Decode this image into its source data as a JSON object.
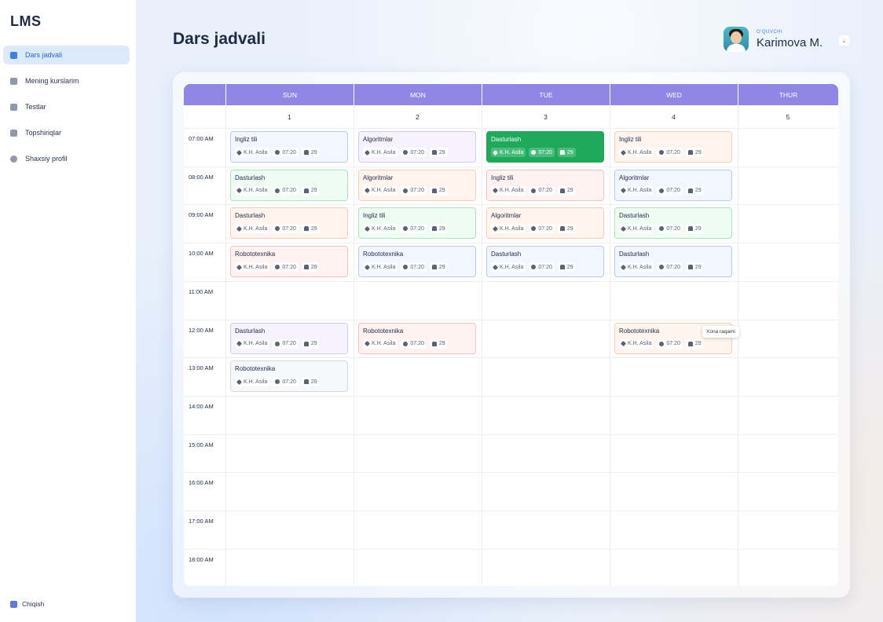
{
  "app": {
    "logo": "LMS",
    "page_title": "Dars jadvali"
  },
  "sidebar": {
    "items": [
      {
        "label": "Dars jadvali",
        "icon": "home-icon",
        "active": true
      },
      {
        "label": "Mening kurslarim",
        "icon": "courses-icon"
      },
      {
        "label": "Testlar",
        "icon": "tests-icon"
      },
      {
        "label": "Topshiriqlar",
        "icon": "tasks-icon"
      },
      {
        "label": "Shaxsiy profil",
        "icon": "user-icon"
      }
    ],
    "logout_label": "Chiqish"
  },
  "user": {
    "role": "O'QUVCHI",
    "name": "Karimova M."
  },
  "calendar": {
    "days": [
      "SUN",
      "MON",
      "TUE",
      "WED",
      "THUR"
    ],
    "dates": [
      "1",
      "2",
      "3",
      "4",
      "5"
    ],
    "times": [
      "07:00 AM",
      "08:00 AM",
      "09:00 AM",
      "10:00 AM",
      "11:00 AM",
      "12:00 AM",
      "13:00 AM",
      "14:00 AM",
      "15:00 AM",
      "16:00 AM",
      "17:00 AM",
      "18:00 AM"
    ],
    "events": [
      {
        "day": 0,
        "slot": 0,
        "title": "Ingliz tili",
        "teacher": "K.H. Asila",
        "time": "07:20",
        "room": "29",
        "color": "blue"
      },
      {
        "day": 1,
        "slot": 0,
        "title": "Algoritmlar",
        "teacher": "K.H. Asila",
        "time": "07:20",
        "room": "29",
        "color": "purple"
      },
      {
        "day": 2,
        "slot": 0,
        "title": "Dasturlash",
        "teacher": "K.H. Asila",
        "time": "07:20",
        "room": "29",
        "color": "solid"
      },
      {
        "day": 3,
        "slot": 0,
        "title": "Ingliz tili",
        "teacher": "K.H. Asila",
        "time": "07:20",
        "room": "29",
        "color": "orange"
      },
      {
        "day": 0,
        "slot": 1,
        "title": "Dasturlash",
        "teacher": "K.H. Asila",
        "time": "07:20",
        "room": "29",
        "color": "green"
      },
      {
        "day": 1,
        "slot": 1,
        "title": "Algoritmlar",
        "teacher": "K.H. Asila",
        "time": "07:20",
        "room": "29",
        "color": "orange"
      },
      {
        "day": 2,
        "slot": 1,
        "title": "Ingliz tili",
        "teacher": "K.H. Asila",
        "time": "07:20",
        "room": "29",
        "color": "pink"
      },
      {
        "day": 3,
        "slot": 1,
        "title": "Algoritmlar",
        "teacher": "K.H. Asila",
        "time": "07:20",
        "room": "29",
        "color": "blue"
      },
      {
        "day": 0,
        "slot": 2,
        "title": "Dasturlash",
        "teacher": "K.H. Asila",
        "time": "07:20",
        "room": "29",
        "color": "orange"
      },
      {
        "day": 1,
        "slot": 2,
        "title": "Ingliz tili",
        "teacher": "K.H. Asila",
        "time": "07:20",
        "room": "29",
        "color": "green"
      },
      {
        "day": 2,
        "slot": 2,
        "title": "Algoritmlar",
        "teacher": "K.H. Asila",
        "time": "07:20",
        "room": "29",
        "color": "orange"
      },
      {
        "day": 3,
        "slot": 2,
        "title": "Dasturlash",
        "teacher": "K.H. Asila",
        "time": "07:20",
        "room": "29",
        "color": "green"
      },
      {
        "day": 0,
        "slot": 3,
        "title": "Robototexnika",
        "teacher": "K.H. Asila",
        "time": "07:20",
        "room": "29",
        "color": "pink"
      },
      {
        "day": 1,
        "slot": 3,
        "title": "Robototexnika",
        "teacher": "K.H. Asila",
        "time": "07:20",
        "room": "29",
        "color": "blue"
      },
      {
        "day": 2,
        "slot": 3,
        "title": "Dasturlash",
        "teacher": "K.H. Asila",
        "time": "07:20",
        "room": "29",
        "color": "blue"
      },
      {
        "day": 3,
        "slot": 3,
        "title": "Dasturlash",
        "teacher": "K.H. Asila",
        "time": "07:20",
        "room": "29",
        "color": "blue"
      },
      {
        "day": 0,
        "slot": 5,
        "title": "Dasturlash",
        "teacher": "K.H. Asila",
        "time": "07:20",
        "room": "29",
        "color": "purple"
      },
      {
        "day": 1,
        "slot": 5,
        "title": "Robototexnika",
        "teacher": "K.H. Asila",
        "time": "07:20",
        "room": "29",
        "color": "pink"
      },
      {
        "day": 3,
        "slot": 5,
        "title": "Robototexnika",
        "teacher": "K.H. Asila",
        "time": "07:20",
        "room": "29",
        "color": "orange"
      },
      {
        "day": 0,
        "slot": 6,
        "title": "Robototexnika",
        "teacher": "K.H. Asila",
        "time": "07:20",
        "room": "29",
        "color": "gray"
      }
    ],
    "tooltip": "Xona raqami"
  }
}
